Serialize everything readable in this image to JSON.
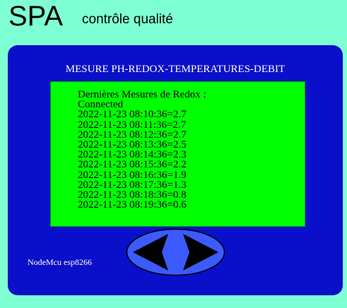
{
  "header": {
    "title": "SPA",
    "subtitle": "contrôle qualité"
  },
  "panel": {
    "title": "MESURE PH-REDOX-TEMPERATURES-DEBIT",
    "display": {
      "heading": "Dernières Mesures de Redox :",
      "status": "Connected",
      "readings": [
        "2022-11-23 08:10:36=2.7",
        "2022-11-23 08:11:36=2.7",
        "2022-11-23 08:12:36=2.7",
        "2022-11-23 08:13:36=2.5",
        "2022-11-23 08:14:36=2.3",
        "2022-11-23 08:15:36=2.2",
        "2022-11-23 08:16:36=1.9",
        "2022-11-23 08:17:36=1.3",
        "2022-11-23 08:18:36=0.8",
        "2022-11-23 08:19:36=0.6"
      ]
    },
    "footer_label": "NodeMcu esp8266",
    "nav_control": {
      "icons": [
        "arrow-left-icon",
        "diamond-icon",
        "arrow-right-icon"
      ]
    }
  },
  "colors": {
    "page_background": "#7fffd4",
    "panel_background": "#0a0fc9",
    "display_background": "#00ff00",
    "nav_oval": "#3b5bff",
    "nav_arrows": "#000000"
  }
}
